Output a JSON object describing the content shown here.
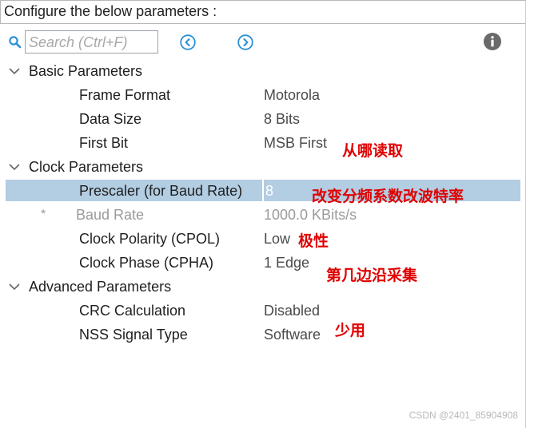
{
  "header": {
    "title": "Configure the below parameters :"
  },
  "toolbar": {
    "search_placeholder": "Search (Ctrl+F)",
    "icons": {
      "search": "search-icon",
      "back": "circle-left-icon",
      "forward": "circle-right-icon",
      "info": "info-icon"
    }
  },
  "sections": [
    {
      "label": "Basic Parameters",
      "params": [
        {
          "label": "Frame Format",
          "value": "Motorola"
        },
        {
          "label": "Data Size",
          "value": "8 Bits"
        },
        {
          "label": "First Bit",
          "value": "MSB First"
        }
      ]
    },
    {
      "label": "Clock Parameters",
      "params": [
        {
          "label": "Prescaler (for Baud Rate)",
          "value": "8"
        },
        {
          "label": "Baud Rate",
          "value": "1000.0 KBits/s",
          "prefix": "*"
        },
        {
          "label": "Clock Polarity (CPOL)",
          "value": "Low"
        },
        {
          "label": "Clock Phase (CPHA)",
          "value": "1 Edge"
        }
      ]
    },
    {
      "label": "Advanced Parameters",
      "params": [
        {
          "label": "CRC Calculation",
          "value": "Disabled"
        },
        {
          "label": "NSS Signal Type",
          "value": "Software"
        }
      ]
    }
  ],
  "annotations": [
    "从哪读取",
    "改变分频系数改波特率",
    "极性",
    "第几边沿采集",
    "少用"
  ],
  "watermark": "CSDN @2401_85904908",
  "colors": {
    "selection": "#b3cde2",
    "annotation": "#e00000",
    "icon_blue": "#2a8fd6"
  }
}
